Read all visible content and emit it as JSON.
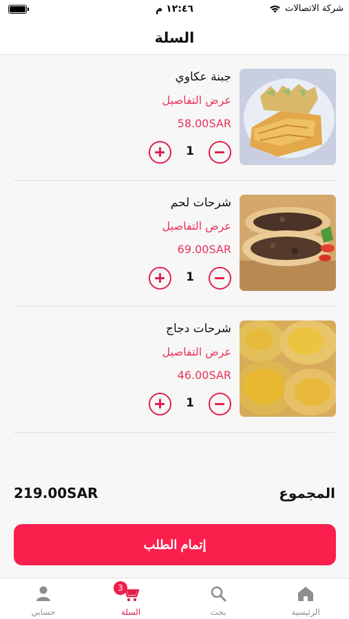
{
  "status_bar": {
    "carrier": "شركة الاتصالات",
    "time": "١٢:٤٦ م"
  },
  "header": {
    "title": "السلة"
  },
  "cart": {
    "items": [
      {
        "name": "جبنة عكاوي",
        "details_label": "عرض التفاصيل",
        "price": "58.00SAR",
        "quantity": "1",
        "image_icon": "cheese-pie-image"
      },
      {
        "name": "شرحات لحم",
        "details_label": "عرض التفاصيل",
        "price": "69.00SAR",
        "quantity": "1",
        "image_icon": "meat-pie-image"
      },
      {
        "name": "شرحات دجاج",
        "details_label": "عرض التفاصيل",
        "price": "46.00SAR",
        "quantity": "1",
        "image_icon": "chicken-pie-image"
      }
    ]
  },
  "summary": {
    "total_label": "المجموع",
    "total_value": "219.00SAR"
  },
  "checkout": {
    "label": "إتمام الطلب"
  },
  "tab_bar": {
    "tabs": [
      {
        "label": "حسابي",
        "icon": "user-icon",
        "active": false
      },
      {
        "label": "السلة",
        "icon": "cart-icon",
        "active": true,
        "badge": "3"
      },
      {
        "label": "بحث",
        "icon": "search-icon",
        "active": false
      },
      {
        "label": "الرئيسية",
        "icon": "home-icon",
        "active": false
      }
    ]
  },
  "colors": {
    "accent": "#fb1f4e",
    "accent_text": "#e8325a",
    "tab_inactive": "#8e8e8e"
  }
}
